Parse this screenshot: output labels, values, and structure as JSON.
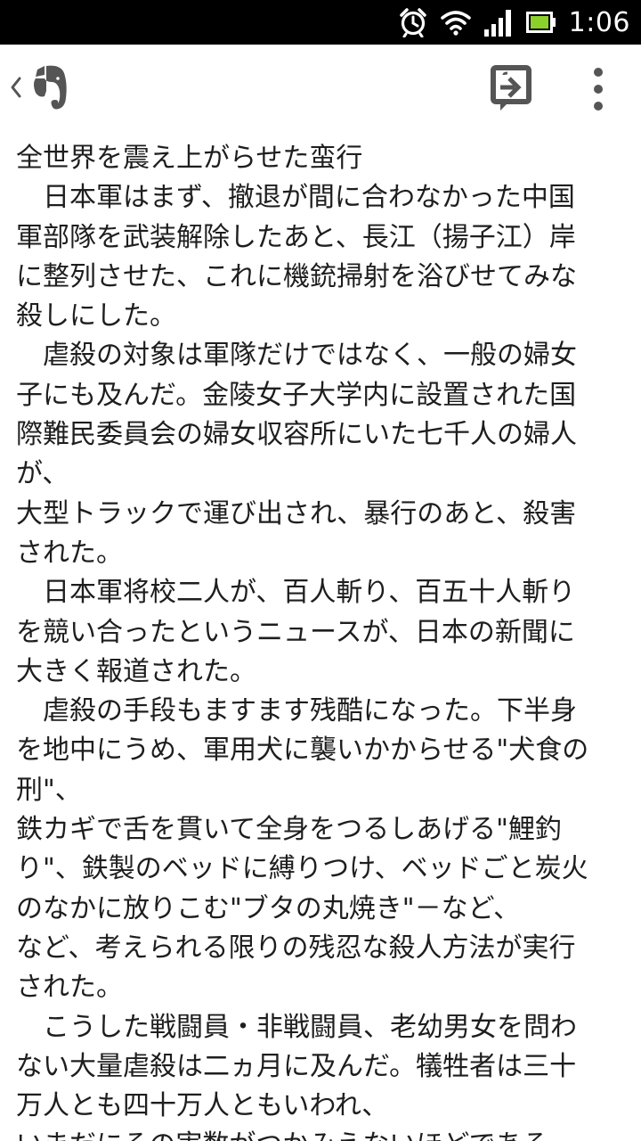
{
  "status_bar": {
    "time": "1:06",
    "icons": [
      "alarm-icon",
      "wifi-icon",
      "signal-icon",
      "battery-icon"
    ]
  },
  "action_bar": {
    "back_icon": "chevron-left-icon",
    "app_icon": "evernote-elephant-icon",
    "share_icon": "share-note-icon",
    "overflow_icon": "overflow-menu-icon"
  },
  "note": {
    "lines": [
      "全世界を震え上がらせた蛮行",
      "　日本軍はまず、撤退が間に合わなかった中国",
      "軍部隊を武装解除したあと、長江（揚子江）岸",
      "に整列させた、これに機銃掃射を浴びせてみな",
      "殺しにした。",
      "　虐殺の対象は軍隊だけではなく、一般の婦女",
      "子にも及んだ。金陵女子大学内に設置された国",
      "際難民委員会の婦女収容所にいた七千人の婦人",
      "が、",
      "大型トラックで運び出され、暴行のあと、殺害",
      "された。",
      "　日本軍将校二人が、百人斬り、百五十人斬り",
      "を競い合ったというニュースが、日本の新聞に",
      "大きく報道された。",
      "　虐殺の手段もますます残酷になった。下半身",
      "を地中にうめ、軍用犬に襲いかからせる\"犬食の",
      "刑\"、",
      "鉄カギで舌を貫いて全身をつるしあげる\"鯉釣",
      "り\"、鉄製のベッドに縛りつけ、ベッドごと炭火",
      "のなかに放りこむ\"ブタの丸焼き\"－など、",
      "など、考えられる限りの残忍な殺人方法が実行",
      "された。",
      "　こうした戦闘員・非戦闘員、老幼男女を問わ",
      "ない大量虐殺は二ヵ月に及んだ。犠牲者は三十",
      "万人とも四十万人ともいわれ、",
      "いまだにその実数がつかみえないほどである。"
    ]
  },
  "colors": {
    "status_bar_bg": "#000000",
    "battery_fill": "#8bd12a",
    "icon_gray": "#555555",
    "text": "#1e1e1e"
  }
}
